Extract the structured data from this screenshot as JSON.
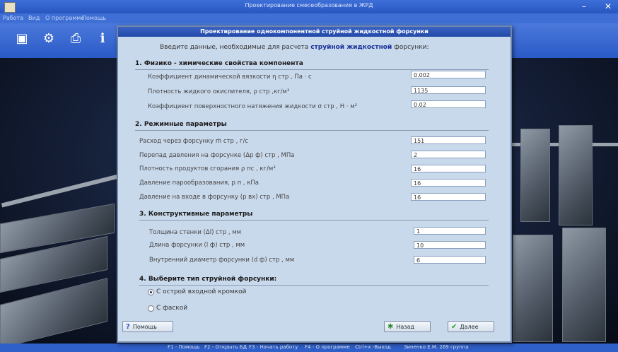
{
  "window": {
    "title": "Проектирование смесеобразования в ЖРД"
  },
  "menu": {
    "items": [
      "Работа",
      "Вид",
      "О программе",
      "Помощь"
    ]
  },
  "toolbar": {
    "tools": [
      "open-db-icon",
      "settings-gear-icon",
      "print-icon",
      "info-icon"
    ]
  },
  "dialog": {
    "title": "Проектирование однокомпонентной струйной жидкостной форсунки",
    "intro_prefix": "Введите данные, необходимые для расчета",
    "intro_strong": "струйной жидкостной",
    "intro_suffix": "форсунки:",
    "sections": [
      {
        "title": "1. Физико - химические свойства компонента",
        "fields": [
          {
            "label": "Коэффициент динамической вязкости  η стр , Па · с",
            "value": "0.002"
          },
          {
            "label": "Плотность жидкого окислителя,  ρ стр ,кг/м³",
            "value": "1135"
          },
          {
            "label": "Коэффициент поверхностного натяжения жидкости  σ стр , Н · м²",
            "value": "0.02"
          }
        ]
      },
      {
        "title": "2. Режимные параметры",
        "fields": [
          {
            "label": "Расход через форсунку  ṁ стр , г/с",
            "value": "151"
          },
          {
            "label": "Перепад давления на форсунке  (Δp ф) стр , МПа",
            "value": "2"
          },
          {
            "label": "Плотность продуктов сгорания  ρ пс , кг/м³",
            "value": "16"
          },
          {
            "label": "Давление парообразования, p п , кПа",
            "value": "16"
          },
          {
            "label": "Давление на входе в форсунку  (p вх) стр , МПа",
            "value": "16"
          }
        ]
      },
      {
        "title": "3. Конструктивные параметры",
        "fields": [
          {
            "label": "Толщина стенки  (Δl) стр , мм",
            "value": "1"
          },
          {
            "label": "Длина форсунки  (l ф) стр , мм",
            "value": "10"
          },
          {
            "label": "Внутренний диаметр форсунки  (d ф) стр , мм",
            "value": "6"
          }
        ]
      },
      {
        "title": "4. Выберите тип струйной форсунки:",
        "options": [
          {
            "label": "С острой входной кромкой",
            "selected": true
          },
          {
            "label": "С фаской",
            "selected": false
          }
        ]
      }
    ],
    "buttons": {
      "help": "Помощь",
      "back": "Назад",
      "next": "Далее"
    }
  },
  "statusbar": {
    "items": [
      "F1 - Помощь",
      "F2 - Открыть БД",
      "F3 - Начать работу",
      "F4 - О программе",
      "Ctrl+x -Выход",
      "Зиненко Е.М. 269 группа"
    ]
  }
}
